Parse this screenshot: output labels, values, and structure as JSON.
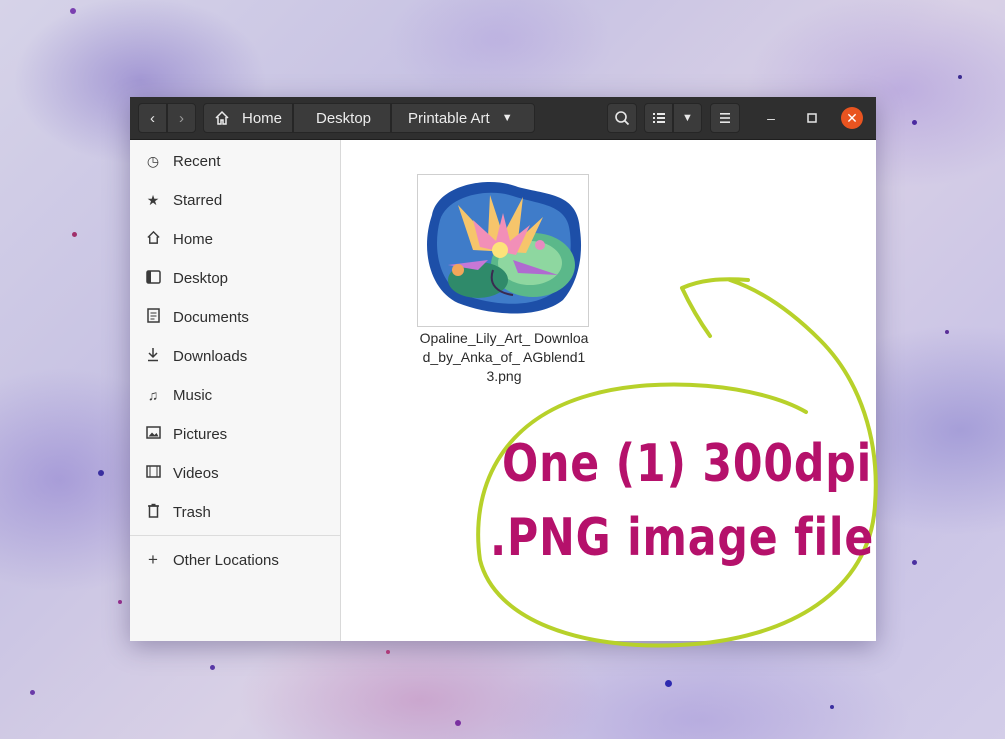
{
  "window": {
    "breadcrumbs": [
      "Home",
      "Desktop",
      "Printable Art"
    ]
  },
  "sidebar": {
    "items": [
      {
        "label": "Recent",
        "icon": "clock-icon"
      },
      {
        "label": "Starred",
        "icon": "star-icon"
      },
      {
        "label": "Home",
        "icon": "home-icon"
      },
      {
        "label": "Desktop",
        "icon": "desktop-icon"
      },
      {
        "label": "Documents",
        "icon": "document-icon"
      },
      {
        "label": "Downloads",
        "icon": "download-icon"
      },
      {
        "label": "Music",
        "icon": "music-icon"
      },
      {
        "label": "Pictures",
        "icon": "picture-icon"
      },
      {
        "label": "Videos",
        "icon": "video-icon"
      },
      {
        "label": "Trash",
        "icon": "trash-icon"
      }
    ],
    "other_locations": "Other Locations"
  },
  "files": [
    {
      "name": "Opaline_Lily_Art_ Download_by_Anka_of_ AGblend13.png",
      "type": "png-image"
    }
  ],
  "annotation": {
    "line1": "One (1) 300dpi",
    "line2": ".PNG image file",
    "text_color": "#b5116b",
    "circle_color": "#b7d12a"
  },
  "colors": {
    "headerbar": "#2f2f2f",
    "close_button": "#e95420",
    "sidebar_bg": "#f7f7f7"
  }
}
